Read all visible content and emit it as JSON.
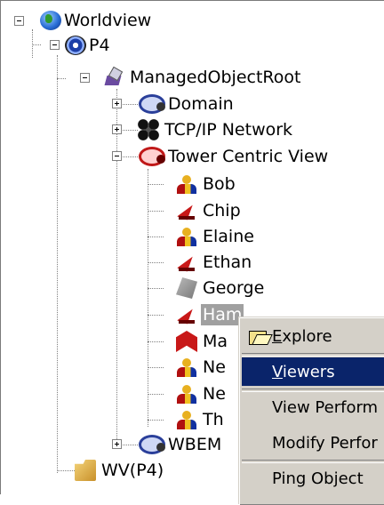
{
  "tree": {
    "root": {
      "label": "Worldview",
      "icon": "globe-icon",
      "expanded": true
    },
    "p4": {
      "label": "P4",
      "icon": "disc-icon",
      "expanded": true
    },
    "managed_object_root": {
      "label": "ManagedObjectRoot",
      "icon": "managed-object-root-icon",
      "expanded": true
    },
    "domain": {
      "label": "Domain",
      "icon": "domain-icon",
      "expanded": false
    },
    "tcpip": {
      "label": "TCP/IP Network",
      "icon": "network-icon",
      "expanded": false
    },
    "tower": {
      "label": "Tower Centric View",
      "icon": "tower-view-icon",
      "expanded": true
    },
    "children": [
      {
        "label": "Bob",
        "icon": "person-icon"
      },
      {
        "label": "Chip",
        "icon": "wedge-icon"
      },
      {
        "label": "Elaine",
        "icon": "person-icon"
      },
      {
        "label": "Ethan",
        "icon": "wedge-icon"
      },
      {
        "label": "George",
        "icon": "server-icon"
      },
      {
        "label": "Ham",
        "icon": "wedge-icon",
        "selected": true
      },
      {
        "label": "Ma",
        "icon": "book-icon"
      },
      {
        "label": "Ne",
        "icon": "person-icon"
      },
      {
        "label": "Ne",
        "icon": "person-icon"
      },
      {
        "label": "Th",
        "icon": "person-icon"
      }
    ],
    "wbem": {
      "label": "WBEM",
      "icon": "domain-icon",
      "expanded": false
    },
    "wv": {
      "label": "WV(P4)",
      "icon": "folder-icon"
    }
  },
  "context_menu": {
    "items": [
      {
        "label": "Explore",
        "icon": "folder-open-icon",
        "highlighted": false
      },
      {
        "label": "Viewers",
        "highlighted": true
      },
      {
        "label": "View Perform",
        "highlighted": false
      },
      {
        "label": "Modify Perfor",
        "highlighted": false
      },
      {
        "label": "Ping Object",
        "highlighted": false
      }
    ]
  },
  "colors": {
    "menu_background": "#d4d0c8",
    "menu_highlight": "#0a246a",
    "selection_grey": "#a0a0a0"
  }
}
